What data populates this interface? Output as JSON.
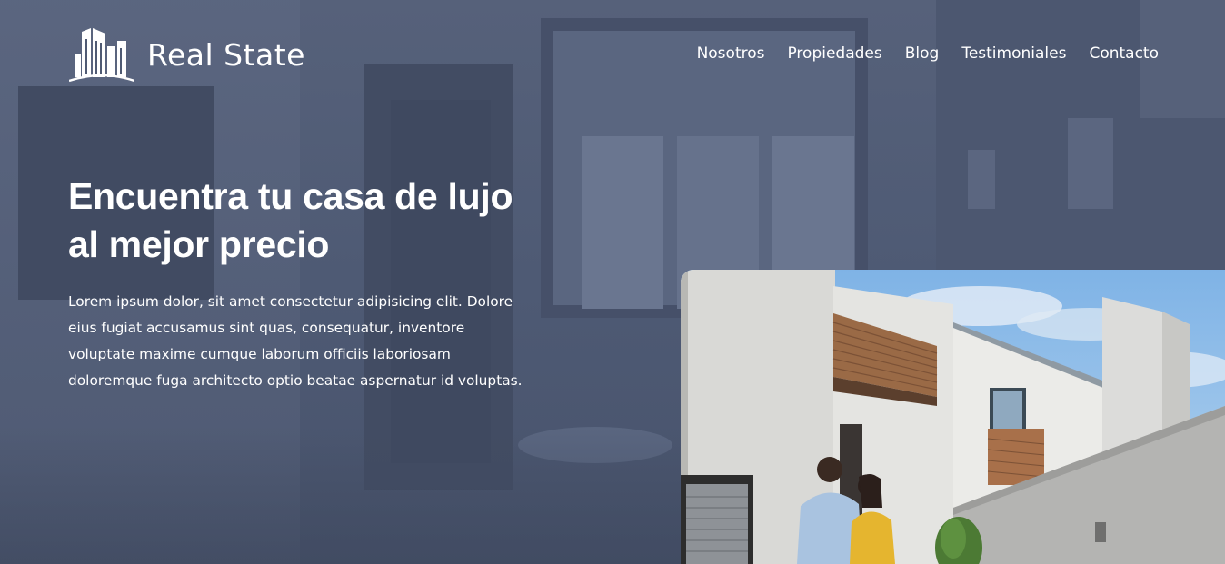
{
  "brand": {
    "name": "Real State",
    "logo_icon": "buildings-icon"
  },
  "nav": {
    "items": [
      {
        "label": "Nosotros"
      },
      {
        "label": "Propiedades"
      },
      {
        "label": "Blog"
      },
      {
        "label": "Testimoniales"
      },
      {
        "label": "Contacto"
      }
    ]
  },
  "hero": {
    "title_line1": "Encuentra tu casa de lujo",
    "title_line2": "al mejor precio",
    "description": "Lorem ipsum dolor, sit amet consectetur adipisicing elit. Dolore eius fugiat accusamus sint quas, consequatur, inventore voluptate maxime cumque laborum officiis laboriosam doloremque fuga architecto optio beatae aspernatur id voluptas."
  },
  "colors": {
    "overlay": "#4b5670",
    "text": "#ffffff"
  }
}
